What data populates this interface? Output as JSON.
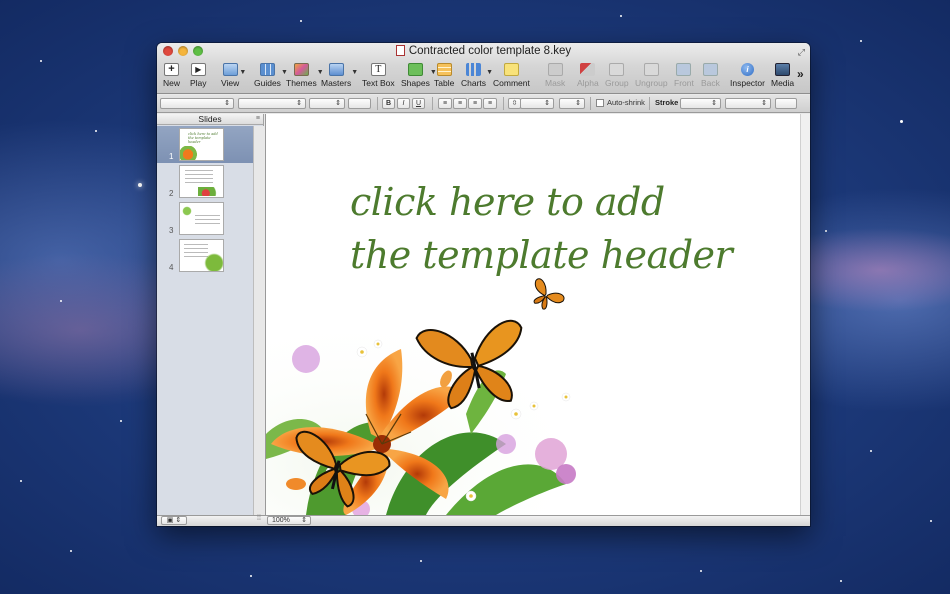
{
  "window": {
    "title": "Contracted color template 8.key",
    "traffic_lights": {
      "close": "#e0493e",
      "minimize": "#f5b53d",
      "zoom": "#5fbf45"
    }
  },
  "toolbar": {
    "items": [
      {
        "label": "New",
        "icon": "plus-icon"
      },
      {
        "label": "Play",
        "icon": "play-icon"
      },
      {
        "label": "View",
        "icon": "view-icon"
      },
      {
        "label": "Guides",
        "icon": "guides-icon"
      },
      {
        "label": "Themes",
        "icon": "themes-icon"
      },
      {
        "label": "Masters",
        "icon": "masters-icon"
      },
      {
        "label": "Text Box",
        "icon": "text-box-icon"
      },
      {
        "label": "Shapes",
        "icon": "shapes-icon"
      },
      {
        "label": "Table",
        "icon": "table-icon"
      },
      {
        "label": "Charts",
        "icon": "charts-icon"
      },
      {
        "label": "Comment",
        "icon": "comment-icon"
      },
      {
        "label": "Mask",
        "icon": "mask-icon"
      },
      {
        "label": "Alpha",
        "icon": "alpha-icon"
      },
      {
        "label": "Group",
        "icon": "group-icon"
      },
      {
        "label": "Ungroup",
        "icon": "ungroup-icon"
      },
      {
        "label": "Front",
        "icon": "front-icon"
      },
      {
        "label": "Back",
        "icon": "back-icon"
      },
      {
        "label": "Inspector",
        "icon": "inspector-icon"
      },
      {
        "label": "Media",
        "icon": "media-icon"
      }
    ],
    "overflow": "»"
  },
  "format_bar": {
    "bold": "B",
    "italic": "I",
    "underline": "U",
    "auto_shrink_label": "Auto-shrink",
    "stroke_label": "Stroke"
  },
  "slides_panel": {
    "title": "Slides",
    "thumbnails": [
      {
        "number": "1"
      },
      {
        "number": "2"
      },
      {
        "number": "3"
      },
      {
        "number": "4"
      }
    ],
    "selected_index": 0
  },
  "slide": {
    "header_text": "click here to add\nthe template header",
    "header_color": "#4d7b2e"
  },
  "status": {
    "zoom": "100%"
  }
}
